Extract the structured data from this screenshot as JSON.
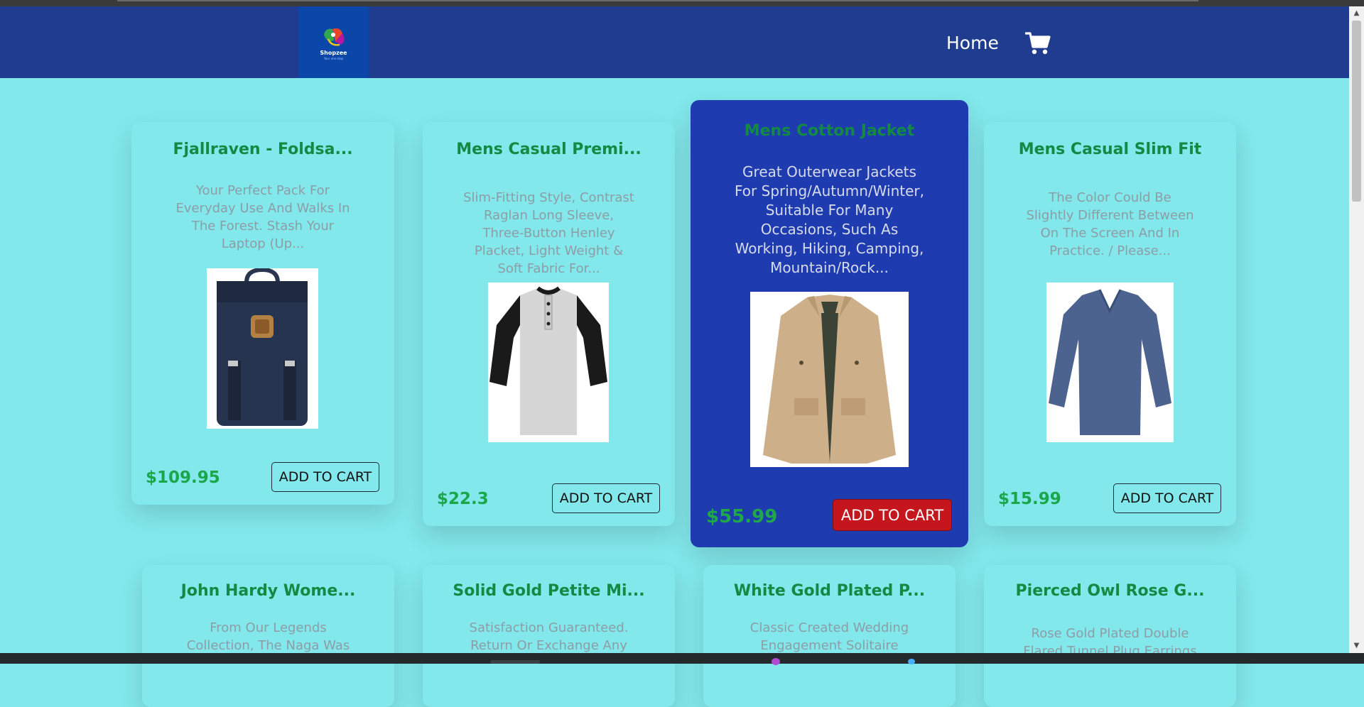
{
  "header": {
    "logo_text": "Shopzee",
    "logo_subtext": "Your one stop",
    "nav_home": "Home",
    "cart_icon": "cart-icon"
  },
  "products": [
    {
      "title": "Fjallraven - Foldsa...",
      "desc": "Your Perfect Pack For Everyday Use And Walks In The Forest. Stash Your Laptop (Up...",
      "price": "$109.95",
      "button": "ADD TO CART",
      "image": "backpack"
    },
    {
      "title": "Mens Casual Premi...",
      "desc": "Slim-Fitting Style, Contrast Raglan Long Sleeve, Three-Button Henley Placket, Light Weight & Soft Fabric For...",
      "price": "$22.3",
      "button": "ADD TO CART",
      "image": "raglan-shirt"
    },
    {
      "title": "Mens Cotton Jacket",
      "desc": "Great Outerwear Jackets For Spring/Autumn/Winter, Suitable For Many Occasions, Such As Working, Hiking, Camping, Mountain/Rock...",
      "price": "$55.99",
      "button": "ADD TO CART",
      "image": "jacket"
    },
    {
      "title": "Mens Casual Slim Fit",
      "desc": "The Color Could Be Slightly Different Between On The Screen And In Practice. / Please...",
      "price": "$15.99",
      "button": "ADD TO CART",
      "image": "tshirt"
    },
    {
      "title": "John Hardy Wome...",
      "desc": "From Our Legends Collection, The Naga Was"
    },
    {
      "title": "Solid Gold Petite Mi...",
      "desc": "Satisfaction Guaranteed. Return Or Exchange Any"
    },
    {
      "title": "White Gold Plated P...",
      "desc": "Classic Created Wedding Engagement Solitaire"
    },
    {
      "title": "Pierced Owl Rose G...",
      "desc": "Rose Gold Plated Double Flared Tunnel Plug Earrings"
    }
  ],
  "colors": {
    "page_bg": "#82e8eb",
    "navbar": "#1f3c8f",
    "title_green": "#138a43",
    "price_green": "#1ca64c",
    "highlight_card": "#1f3bb0",
    "highlight_button": "#c4161c"
  }
}
